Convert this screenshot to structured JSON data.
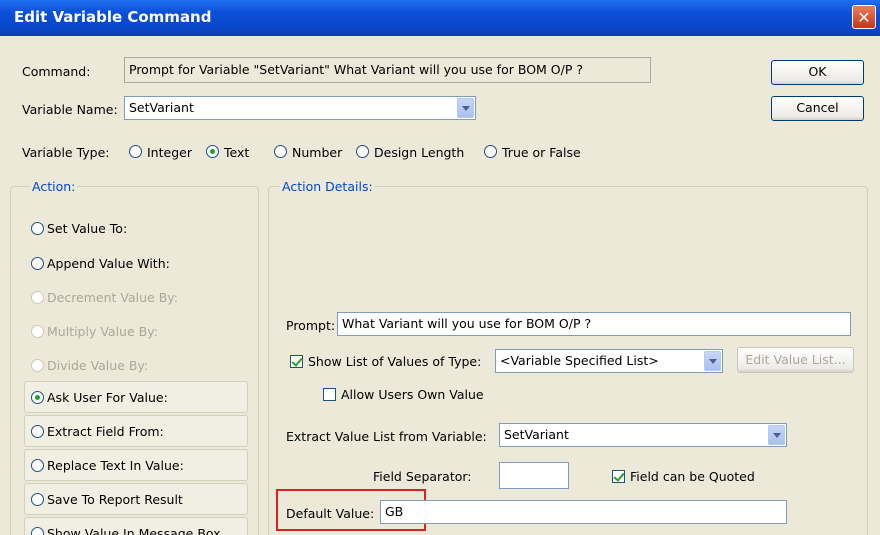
{
  "window": {
    "title": "Edit Variable Command",
    "close_glyph": "✕"
  },
  "command": {
    "label": "Command:",
    "value": "Prompt for Variable \"SetVariant\"  What Variant will you use for BOM O/P ?"
  },
  "buttons": {
    "ok": "OK",
    "cancel": "Cancel"
  },
  "variable_name": {
    "label": "Variable Name:",
    "value": "SetVariant"
  },
  "variable_type": {
    "label": "Variable Type:",
    "options": [
      "Integer",
      "Text",
      "Number",
      "Design Length",
      "True or False"
    ],
    "selected": "Text"
  },
  "action": {
    "label": "Action:",
    "items": [
      {
        "label": "Set Value To:",
        "enabled": true,
        "selected": false
      },
      {
        "label": "Append Value With:",
        "enabled": true,
        "selected": false
      },
      {
        "label": "Decrement Value By:",
        "enabled": false,
        "selected": false
      },
      {
        "label": "Multiply Value By:",
        "enabled": false,
        "selected": false
      },
      {
        "label": "Divide Value By:",
        "enabled": false,
        "selected": false
      },
      {
        "label": "Ask User For Value:",
        "enabled": true,
        "selected": true
      },
      {
        "label": "Extract Field From:",
        "enabled": true,
        "selected": false
      },
      {
        "label": "Replace Text In Value:",
        "enabled": true,
        "selected": false
      },
      {
        "label": "Save To Report Result",
        "enabled": true,
        "selected": false
      },
      {
        "label": "Show Value In Message Box",
        "enabled": true,
        "selected": false
      }
    ]
  },
  "details": {
    "label": "Action Details:",
    "prompt": {
      "label": "Prompt:",
      "value": "What Variant will you use for BOM O/P ?"
    },
    "show_list": {
      "label": "Show List of Values of Type:",
      "checked": true,
      "value": "<Variable Specified List>"
    },
    "edit_value_list": "Edit Value List...",
    "allow_own": {
      "label": "Allow Users Own Value",
      "checked": false
    },
    "extract_list": {
      "label": "Extract Value List from Variable:",
      "value": "SetVariant"
    },
    "field_separator": {
      "label": "Field Separator:",
      "value": ""
    },
    "field_quoted": {
      "label": "Field can be Quoted",
      "checked": true
    },
    "default_value": {
      "label": "Default Value:",
      "value": "GB"
    }
  },
  "highlight_color": "#e02020"
}
